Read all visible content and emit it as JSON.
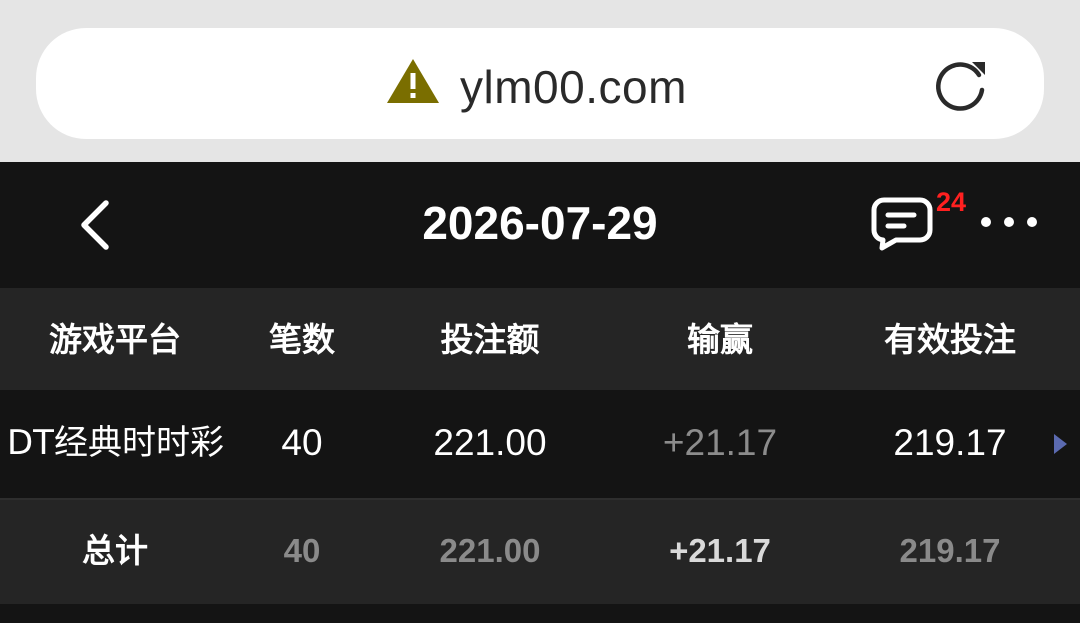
{
  "browser": {
    "url": "ylm00.com",
    "warning_icon": "warning-triangle-icon",
    "reload_icon": "reload-icon"
  },
  "header": {
    "title": "2026-07-29",
    "message_badge": "24",
    "back_icon": "chevron-left-icon",
    "message_icon": "chat-bubble-icon",
    "more_icon": "more-horizontal-icon"
  },
  "table": {
    "columns": [
      "游戏平台",
      "笔数",
      "投注额",
      "输赢",
      "有效投注"
    ],
    "rows": [
      {
        "platform": "DT经典时时彩",
        "count": "40",
        "bet": "221.00",
        "win_loss": "+21.17",
        "valid_bet": "219.17"
      }
    ],
    "total": {
      "label": "总计",
      "count": "40",
      "bet": "221.00",
      "win_loss": "+21.17",
      "valid_bet": "219.17"
    }
  },
  "colors": {
    "header_bg": "#141414",
    "row_alt_bg": "#252525",
    "badge": "#ff2020",
    "arrow": "#5b6ab0",
    "warning": "#7a6e00"
  }
}
